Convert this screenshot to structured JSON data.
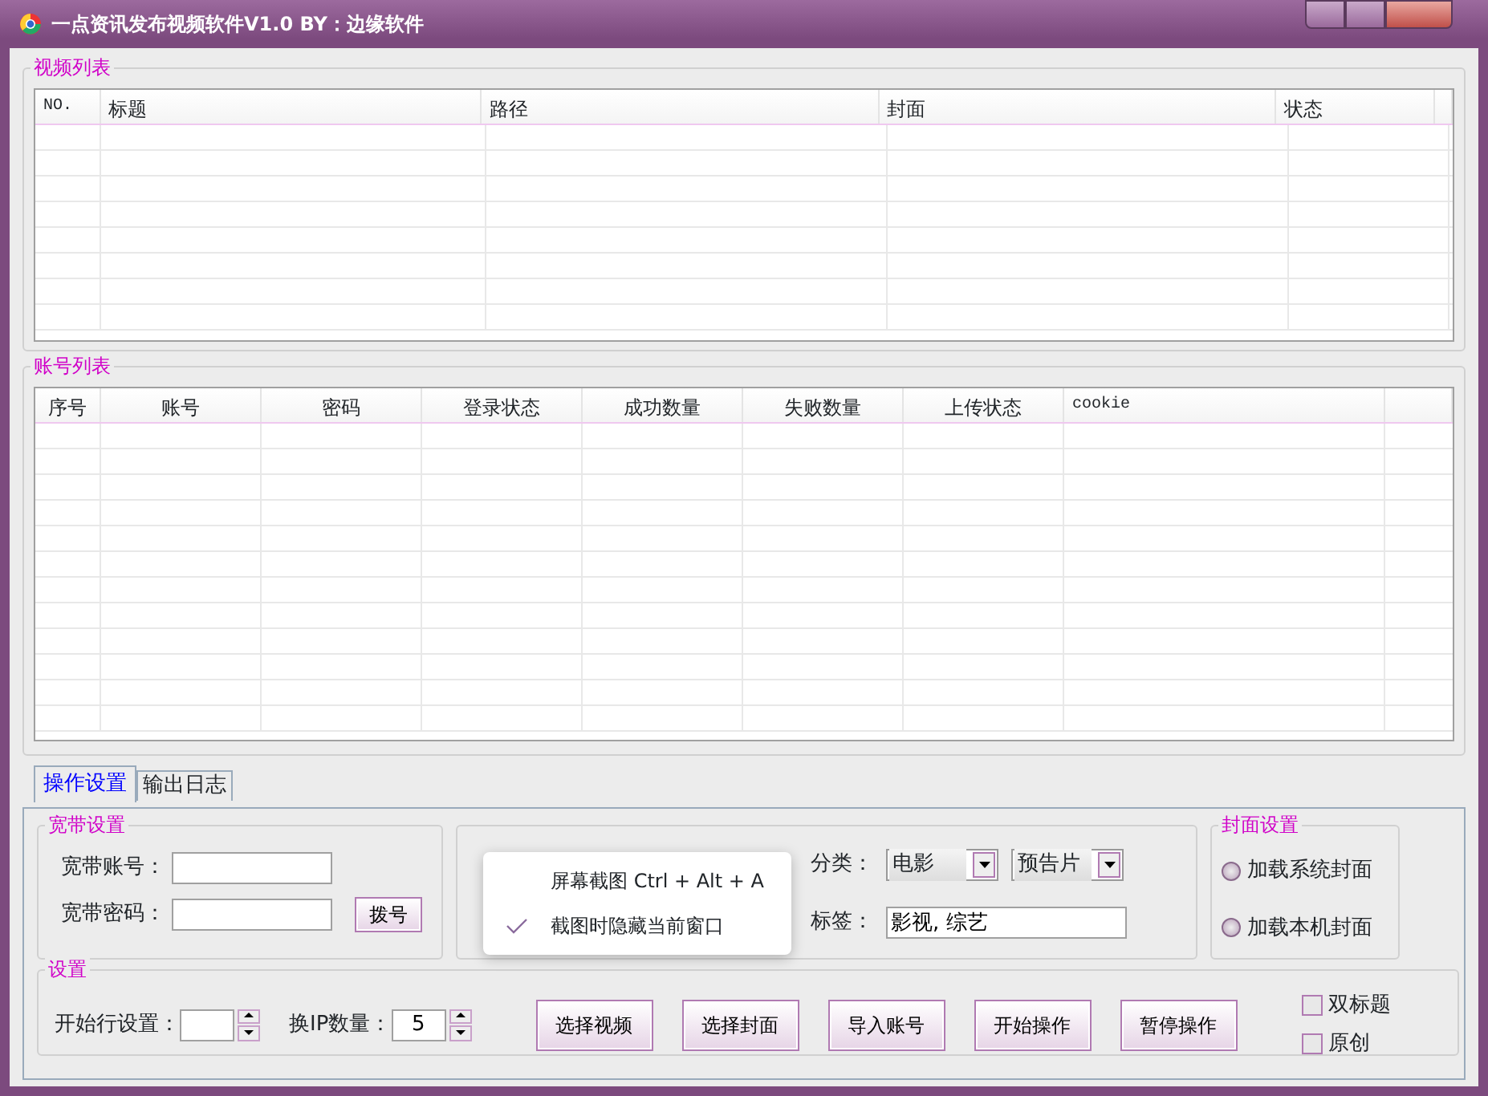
{
  "window": {
    "title": "一点资讯发布视频软件V1.0 BY：边缘软件"
  },
  "video_list": {
    "title": "视频列表",
    "columns": [
      "NO.",
      "标题",
      "路径",
      "封面",
      "状态"
    ]
  },
  "account_list": {
    "title": "账号列表",
    "columns": [
      "序号",
      "账号",
      "密码",
      "登录状态",
      "成功数量",
      "失败数量",
      "上传状态",
      "cookie"
    ]
  },
  "tabs": [
    {
      "label": "操作设置",
      "selected": true
    },
    {
      "label": "输出日志",
      "selected": false
    }
  ],
  "broadband": {
    "title": "宽带设置",
    "fields": [
      {
        "label": "宽带账号："
      },
      {
        "label": "宽带密码："
      }
    ],
    "button": "拨号"
  },
  "category": {
    "label": "分类：",
    "selects": [
      "电影",
      "预告片"
    ]
  },
  "tags": {
    "label": "标签：",
    "value": "影视, 综艺"
  },
  "cover": {
    "title": "封面设置",
    "options": [
      {
        "label": "加载系统封面",
        "selected": false
      },
      {
        "label": "加载本机封面",
        "selected": false
      }
    ]
  },
  "settings": {
    "title": "设置",
    "spinners": [
      {
        "label": "开始行设置："
      },
      {
        "label": "换IP数量：",
        "value": "5"
      }
    ],
    "buttons": [
      "选择视频",
      "选择封面",
      "导入账号",
      "开始操作",
      "暂停操作"
    ],
    "checkboxes": [
      {
        "label": "双标题",
        "checked": false
      },
      {
        "label": "原创",
        "checked": false
      }
    ]
  },
  "context_menu": {
    "items": [
      {
        "label": "屏幕截图 Ctrl + Alt + A",
        "checked": false
      },
      {
        "label": "截图时隐藏当前窗口",
        "checked": true
      }
    ]
  }
}
